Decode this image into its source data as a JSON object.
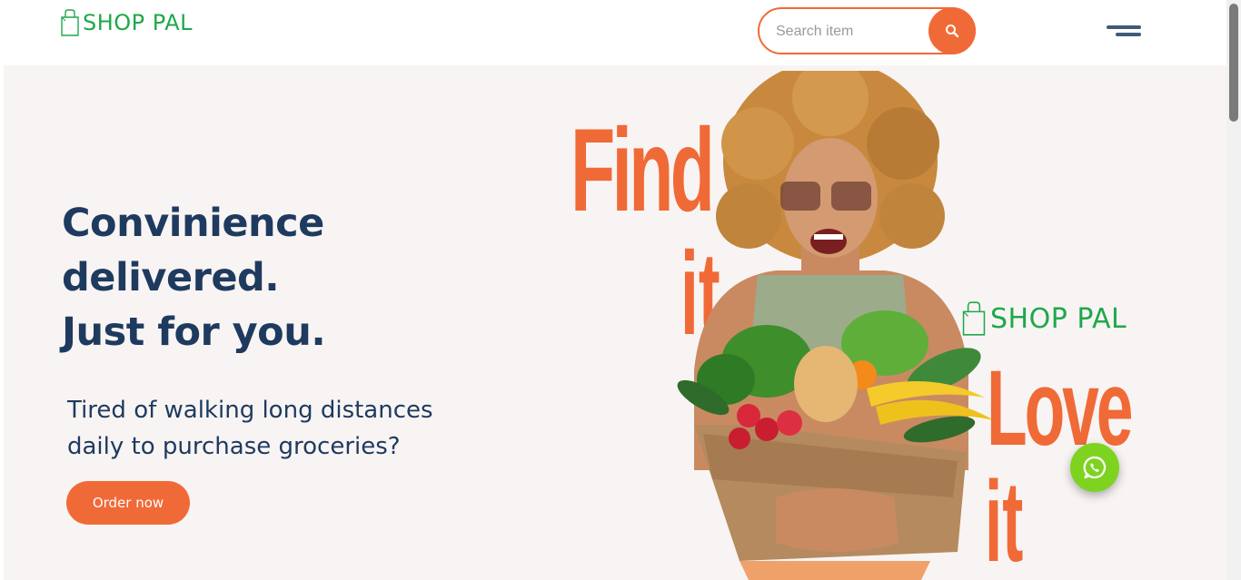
{
  "header": {
    "logo_text": "SHOP PAL",
    "search_placeholder": "Search item"
  },
  "hero": {
    "headline": [
      "Convinience",
      "delivered.",
      "Just for you."
    ],
    "subtext": [
      "Tired of walking long distances",
      "daily to purchase groceries?"
    ],
    "cta_label": "Order now",
    "graphic": {
      "word_top": "Find",
      "word_top_2": "it",
      "word_bottom": "Love",
      "word_bottom_2": "it",
      "logo_text": "SHOP PAL"
    }
  },
  "icons": {
    "logo": "shopping-bag-icon",
    "search": "search-icon",
    "menu": "hamburger-menu-icon",
    "chat": "whatsapp-icon"
  },
  "colors": {
    "brand_green": "#1fa84a",
    "accent_orange": "#f06a37",
    "navy": "#1e3a5f",
    "background": "#f8f4f3",
    "whatsapp_green": "#7ed321"
  }
}
